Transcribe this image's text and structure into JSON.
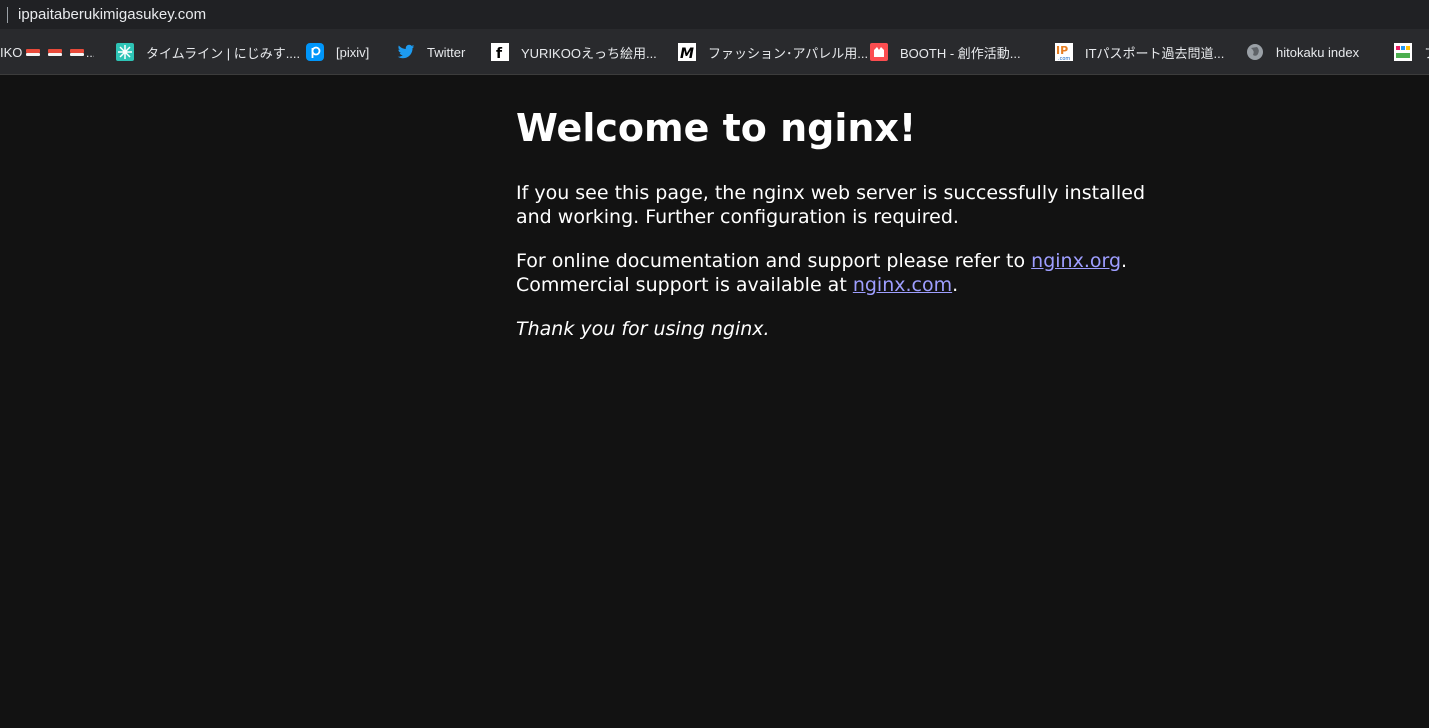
{
  "address_bar": {
    "url": "ippaitaberukimigasukey.com"
  },
  "bookmarks": [
    {
      "label": "IKO",
      "icon": "sushi-icon"
    },
    {
      "label": "タイムライン | にじみす....",
      "icon": "nijimiss-icon"
    },
    {
      "label": "[pixiv]",
      "icon": "pixiv-icon"
    },
    {
      "label": "Twitter",
      "icon": "twitter-icon"
    },
    {
      "label": "YURIKOOえっち絵用...",
      "icon": "fanbox-icon"
    },
    {
      "label": "ファッション･アパレル用...",
      "icon": "m-logo-icon"
    },
    {
      "label": "BOOTH - 創作活動...",
      "icon": "booth-icon"
    },
    {
      "label": "ITパスポート過去問道...",
      "icon": "ip-icon"
    },
    {
      "label": "hitokaku index",
      "icon": "globe-icon"
    },
    {
      "label": "フ",
      "icon": "fantia-icon"
    }
  ],
  "page": {
    "heading": "Welcome to nginx!",
    "paragraph1": "If you see this page, the nginx web server is successfully installed and working. Further configuration is required.",
    "paragraph2_prefix": "For online documentation and support please refer to ",
    "link_org": "nginx.org",
    "paragraph2_mid": ".",
    "paragraph2_line2": "Commercial support is available at ",
    "link_com": "nginx.com",
    "paragraph2_end": ".",
    "thanks": "Thank you for using nginx."
  },
  "colors": {
    "background": "#121212",
    "link": "#9e9eff",
    "toolbar": "#292a2d"
  }
}
